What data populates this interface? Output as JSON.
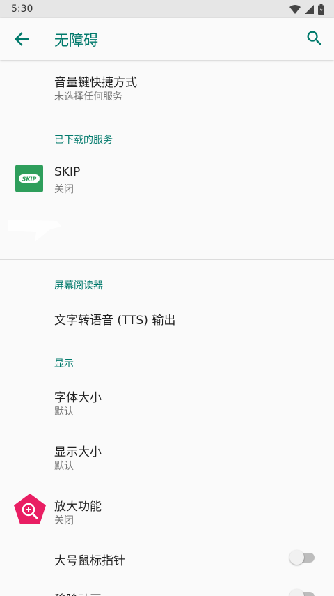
{
  "status": {
    "time": "5:30"
  },
  "appbar": {
    "title": "无障碍"
  },
  "shortcut": {
    "title": "音量键快捷方式",
    "summary": "未选择任何服务"
  },
  "downloaded": {
    "header": "已下载的服务",
    "skip": {
      "icon_text": "SKIP",
      "title": "SKIP",
      "summary": "关闭"
    }
  },
  "screen_reader": {
    "header": "屏幕阅读器",
    "tts": "文字转语音 (TTS) 输出"
  },
  "display": {
    "header": "显示",
    "font_size": {
      "title": "字体大小",
      "summary": "默认"
    },
    "display_size": {
      "title": "显示大小",
      "summary": "默认"
    },
    "magnification": {
      "title": "放大功能",
      "summary": "关闭"
    },
    "large_pointer": {
      "title": "大号鼠标指针",
      "on": false
    },
    "remove_animations": {
      "title": "移除动画",
      "on": false
    }
  },
  "colors": {
    "accent": "#00796b",
    "skip_green": "#2e9e5b",
    "magnify_pink": "#e91e63"
  }
}
